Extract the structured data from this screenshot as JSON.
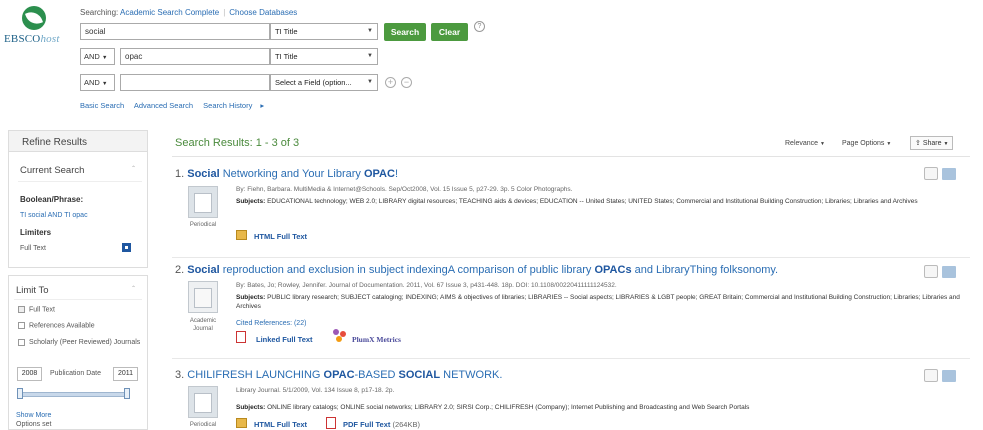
{
  "header": {
    "logo_text": "EBSCO",
    "logo_text_host": "host",
    "searching_label": "Searching:",
    "database": "Academic Search Complete",
    "choose_databases": "Choose Databases",
    "rows": [
      {
        "bool": "",
        "value": "social",
        "field": "TI Title"
      },
      {
        "bool": "AND",
        "value": "opac",
        "field": "TI Title"
      },
      {
        "bool": "AND",
        "value": "",
        "field": "Select a Field (option..."
      }
    ],
    "search_button": "Search",
    "clear_button": "Clear",
    "help": "?",
    "plus": "+",
    "minus": "−",
    "links": [
      "Basic Search",
      "Advanced Search",
      "Search History"
    ]
  },
  "sidebar": {
    "refine_title": "Refine Results",
    "current_search_title": "Current Search",
    "boolean_label": "Boolean/Phrase:",
    "boolean_value": "TI social AND TI opac",
    "limiters_label": "Limiters",
    "limiter_value": "Full Text",
    "limit_to_title": "Limit To",
    "limit_options": [
      {
        "label": "Full Text",
        "checked": true
      },
      {
        "label": "References Available",
        "checked": false
      },
      {
        "label": "Scholarly (Peer Reviewed) Journals",
        "checked": false
      }
    ],
    "date_from": "2008",
    "pub_date_label": "Publication Date",
    "date_to": "2011",
    "show_more": "Show More",
    "options_set": "Options set"
  },
  "results": {
    "title": "Search Results: 1 - 3 of 3",
    "relevance": "Relevance",
    "page_options": "Page Options",
    "share": "Share",
    "items": [
      {
        "num": "1.",
        "title_pre": "",
        "title_b1": "Social",
        "title_mid": " Networking and Your Library ",
        "title_b2": "OPAC",
        "title_post": "!",
        "meta": "By: Fiehn, Barbara. MultiMedia & Internet@Schools. Sep/Oct2008, Vol. 15 Issue 5, p27-29. 3p. 5 Color Photographs.",
        "subjects_label": "Subjects:",
        "subjects": "EDUCATIONAL technology; WEB 2.0; LIBRARY digital resources; TEACHING aids & devices; EDUCATION -- United States; UNITED States; Commercial and Institutional Building Construction; Libraries; Libraries and Archives",
        "doc_type": "Periodical",
        "link1": "HTML Full Text"
      },
      {
        "num": "2.",
        "title_pre": "",
        "title_b1": "Social",
        "title_mid": " reproduction and exclusion in subject indexingA comparison of public library ",
        "title_b2": "OPACs",
        "title_post": " and LibraryThing folksonomy.",
        "meta": "By: Bates, Jo; Rowley, Jennifer. Journal of Documentation. 2011, Vol. 67 Issue 3, p431-448. 18p. DOI: 10.1108/00220411111124532.",
        "subjects_label": "Subjects:",
        "subjects": "PUBLIC library research; SUBJECT cataloging; INDEXING; AIMS & objectives of libraries; LIBRARIES -- Social aspects; LIBRARIES & LGBT people; GREAT Britain; Commercial and Institutional Building Construction; Libraries; Libraries and Archives",
        "doc_type": "Academic Journal",
        "cited": "Cited References: (22)",
        "link1": "Linked Full Text",
        "link2": "PlumX Metrics"
      },
      {
        "num": "3.",
        "title_pre": "CHILIFRESH LAUNCHING ",
        "title_b1": "OPAC",
        "title_mid": "-BASED ",
        "title_b2": "SOCIAL",
        "title_post": " NETWORK.",
        "meta": "Library Journal. 5/1/2009, Vol. 134 Issue 8, p17-18. 2p.",
        "subjects_label": "Subjects:",
        "subjects": "ONLINE library catalogs; ONLINE social networks; LIBRARY 2.0; SIRSI Corp.; CHILIFRESH (Company); Internet Publishing and Broadcasting and Web Search Portals",
        "doc_type": "Periodical",
        "link1": "HTML Full Text",
        "link2": "PDF Full Text",
        "link2_size": "(264KB)"
      }
    ]
  },
  "colors": {
    "green": "#4c9a3f",
    "link": "#2a6db3",
    "brand": "#2c8f4e"
  }
}
